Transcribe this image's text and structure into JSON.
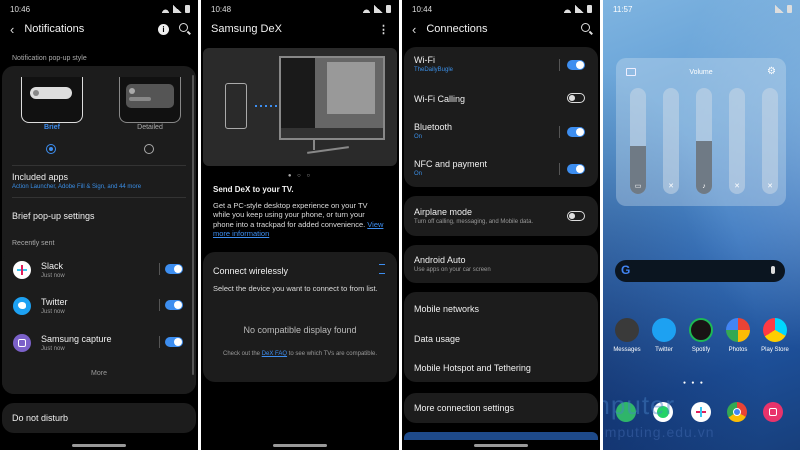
{
  "notifications": {
    "status_time": "10:46",
    "title": "Notifications",
    "popup_style_label": "Notification pop-up style",
    "brief_label": "Brief",
    "detailed_label": "Detailed",
    "included_apps_title": "Included apps",
    "included_apps_sub": "Action Launcher, Adobe Fill & Sign, and 44 more",
    "brief_popup_settings": "Brief pop-up settings",
    "recently_sent_label": "Recently sent",
    "apps": [
      {
        "name": "Slack",
        "time": "Just now"
      },
      {
        "name": "Twitter",
        "time": "Just now"
      },
      {
        "name": "Samsung capture",
        "time": "Just now"
      }
    ],
    "more_label": "More",
    "do_not_disturb": "Do not disturb"
  },
  "dex": {
    "status_time": "10:48",
    "title": "Samsung DeX",
    "send_title": "Send DeX to your TV.",
    "send_body": "Get a PC-style desktop experience on your TV while you keep using your phone, or turn your phone into a trackpad for added convenience.",
    "view_more": "View more information",
    "connect_title": "Connect wirelessly",
    "connect_body": "Select the device you want to connect to from list.",
    "no_display": "No compatible display found",
    "faq_pre": "Check out the ",
    "faq_link": "DeX FAQ",
    "faq_post": " to see which TVs are compatible."
  },
  "connections": {
    "status_time": "10:44",
    "title": "Connections",
    "items": [
      {
        "title": "Wi-Fi",
        "sub": "TheDailyBugle"
      },
      {
        "title": "Wi-Fi Calling",
        "sub": ""
      },
      {
        "title": "Bluetooth",
        "sub": "On"
      },
      {
        "title": "NFC and payment",
        "sub": "On"
      },
      {
        "title": "Airplane mode",
        "sub": "Turn off calling, messaging, and Mobile data."
      },
      {
        "title": "Android Auto",
        "sub": "Use apps on your car screen"
      },
      {
        "title": "Mobile networks",
        "sub": ""
      },
      {
        "title": "Data usage",
        "sub": ""
      },
      {
        "title": "Mobile Hotspot and Tethering",
        "sub": ""
      },
      {
        "title": "More connection settings",
        "sub": ""
      }
    ]
  },
  "home": {
    "status_time": "11:57",
    "volume_label": "Volume",
    "volume_levels": [
      0.45,
      0.0,
      0.5,
      0.0,
      0.0
    ],
    "apps": [
      "Messages",
      "Twitter",
      "Spotify",
      "Photos",
      "Play Store"
    ],
    "watermark": "Computer",
    "watermark_sub": "computing.edu.vn"
  },
  "colors": {
    "accent": "#3d8ef0",
    "background": "#000000",
    "card": "#1c1c1c"
  }
}
